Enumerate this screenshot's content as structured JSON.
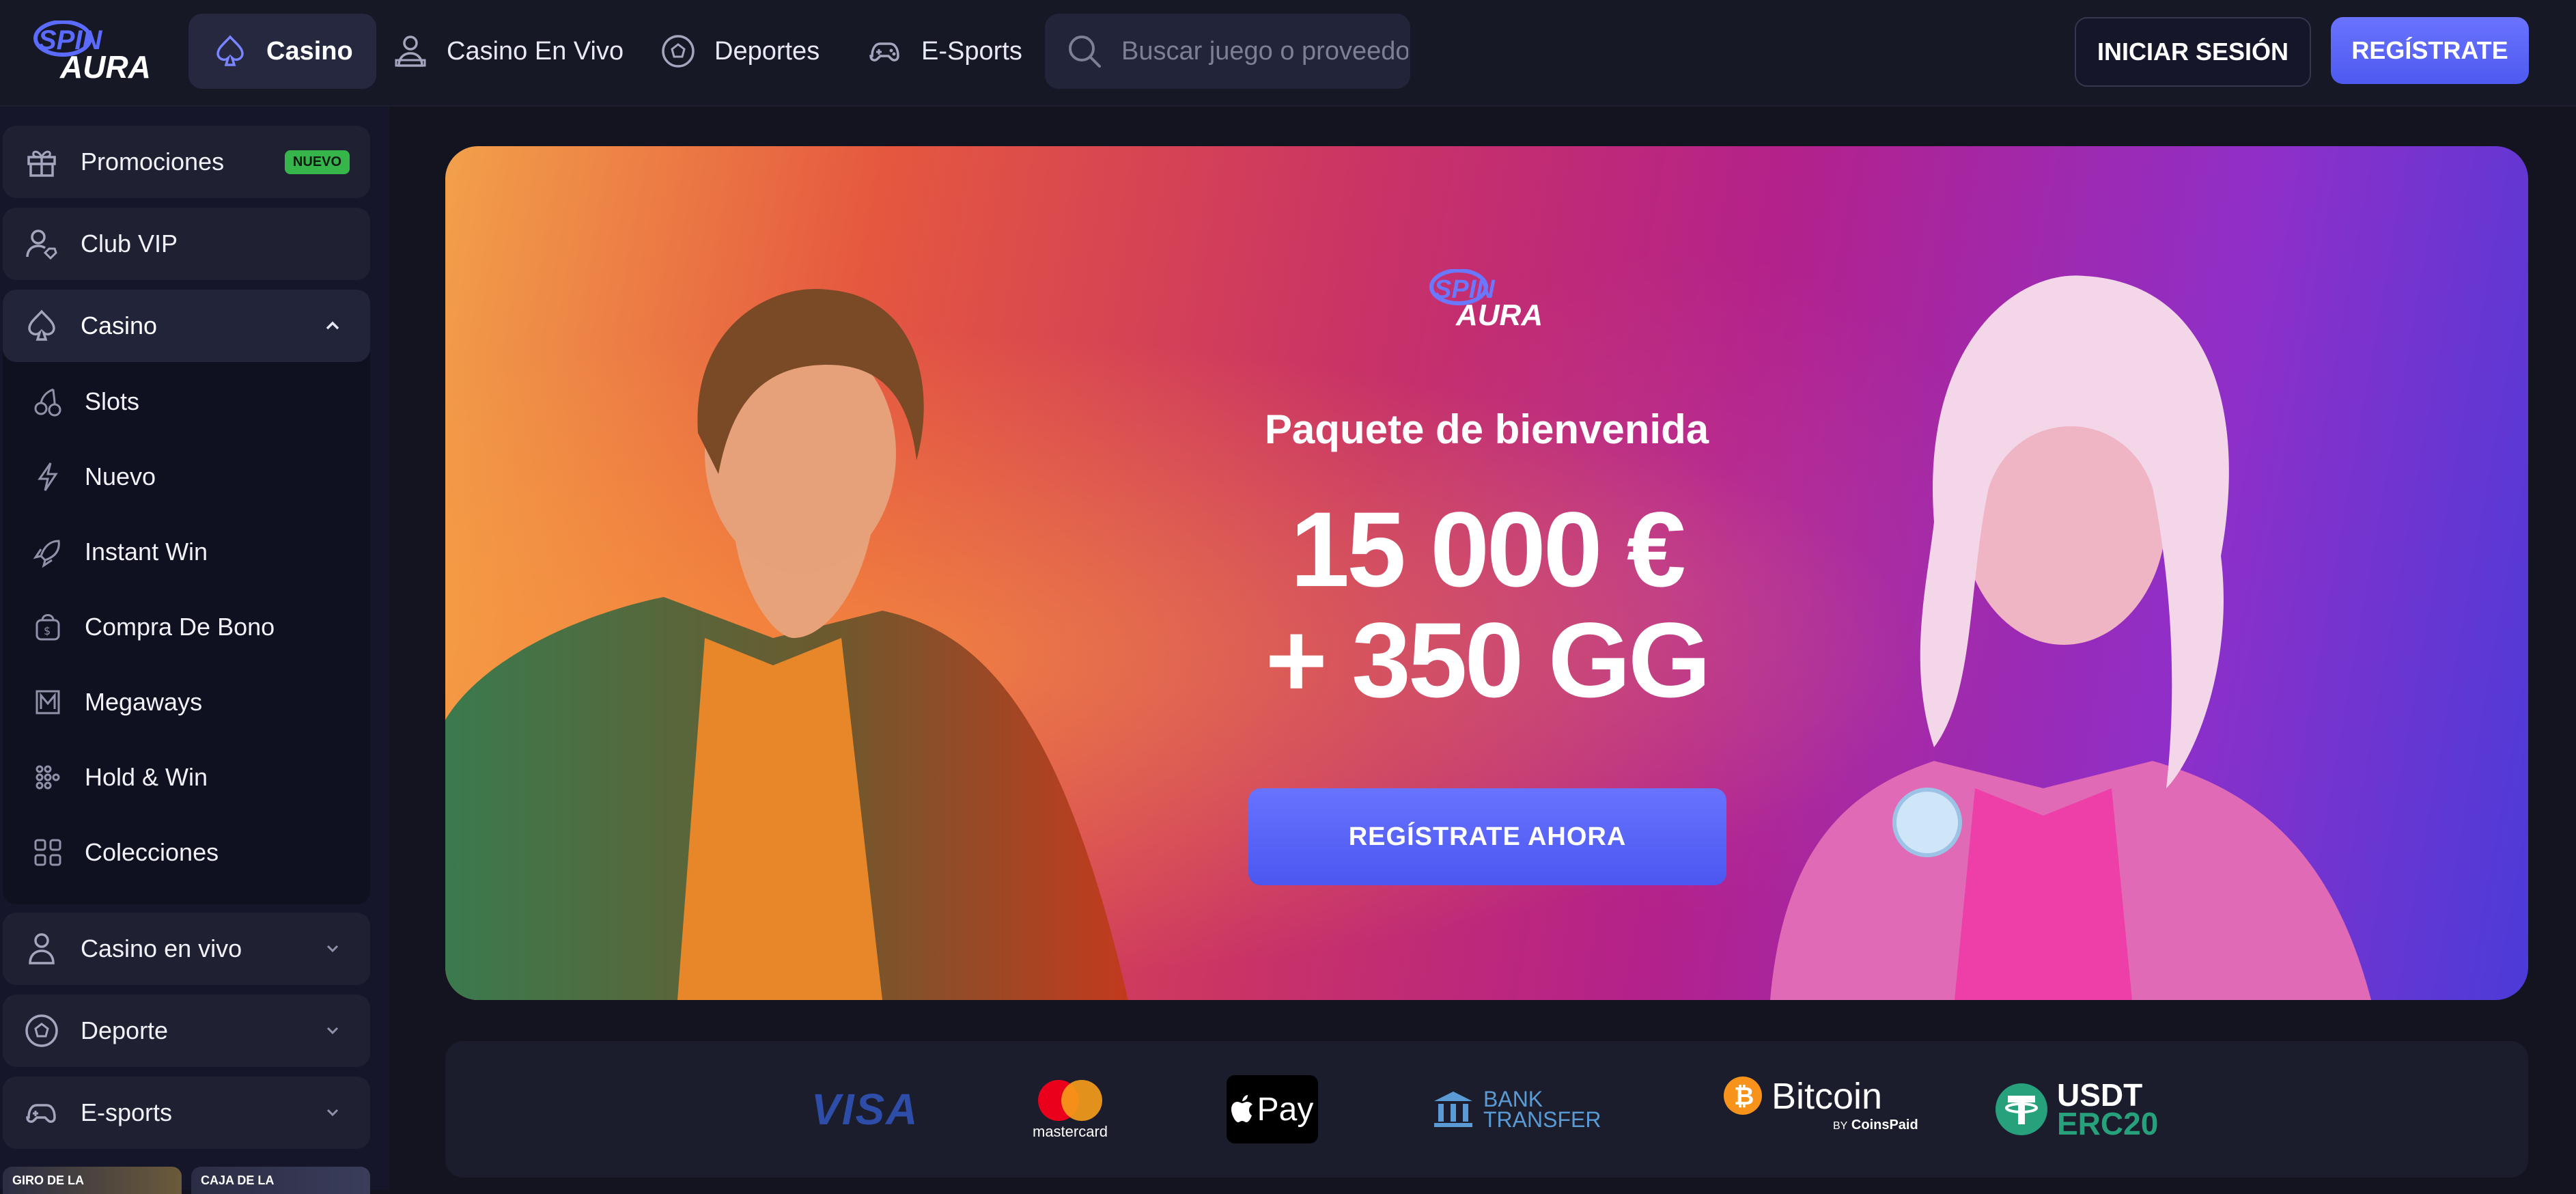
{
  "brand": {
    "logo_line1": "SPIN",
    "logo_line2": "AURA"
  },
  "nav": {
    "items": [
      {
        "label": "Casino",
        "icon": "spade-icon",
        "active": true
      },
      {
        "label": "Casino En Vivo",
        "icon": "dealer-icon"
      },
      {
        "label": "Deportes",
        "icon": "soccer-ball-icon"
      },
      {
        "label": "E-Sports",
        "icon": "gamepad-icon"
      }
    ],
    "search_placeholder": "Buscar juego o proveedor",
    "login_label": "INICIAR SESIÓN",
    "register_label": "REGÍSTRATE"
  },
  "sidebar": {
    "promo": {
      "label": "Promociones",
      "badge": "NUEVO"
    },
    "vip": {
      "label": "Club VIP"
    },
    "casino": {
      "label": "Casino",
      "items": [
        {
          "label": "Slots",
          "icon": "cherries-icon"
        },
        {
          "label": "Nuevo",
          "icon": "lightning-icon"
        },
        {
          "label": "Instant Win",
          "icon": "rocket-icon"
        },
        {
          "label": "Compra De Bono",
          "icon": "bonus-bag-icon"
        },
        {
          "label": "Megaways",
          "icon": "megaways-icon"
        },
        {
          "label": "Hold & Win",
          "icon": "grid-dots-icon"
        },
        {
          "label": "Colecciones",
          "icon": "collections-icon"
        }
      ]
    },
    "live": {
      "label": "Casino en vivo"
    },
    "sport": {
      "label": "Deporte"
    },
    "esports": {
      "label": "E-sports"
    },
    "thumbs": [
      "GIRO DE LA",
      "CAJA DE LA"
    ]
  },
  "banner": {
    "subtitle": "Paquete de bienvenida",
    "amount_line1": "15 000 €",
    "amount_line2": "+ 350 GG",
    "cta_label": "REGÍSTRATE AHORA",
    "colors": {
      "warm": "#e5573f",
      "pink": "#c93366",
      "violet": "#8f2fc9",
      "blue": "#4b3bd8"
    }
  },
  "payments": {
    "visa": "VISA",
    "mastercard": "mastercard",
    "applepay": "Pay",
    "bank_line1": "BANK",
    "bank_line2": "TRANSFER",
    "bitcoin": "Bitcoin",
    "bitcoin_by": "BY",
    "coinspaid": "CoinsPaid",
    "usdt_line1": "USDT",
    "usdt_line2": "ERC20"
  }
}
